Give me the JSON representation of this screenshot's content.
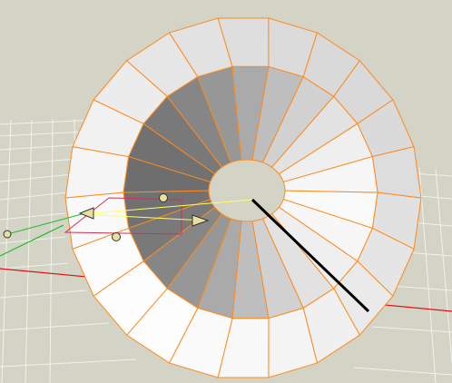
{
  "viewport": {
    "mode": "3d-perspective",
    "background_color": "#d3d3c6",
    "grid_color": "#f2f2ee",
    "axis_x_color": "#e01010",
    "axis_y_color": "#22bb22",
    "selected_object": "torus",
    "selection_wire_color": "#ff8a1e",
    "gizmo_color": "#ffff66",
    "icons": [
      "cone-gizmo-handle",
      "sphere-gizmo-handle",
      "pivot-axis-line"
    ]
  }
}
